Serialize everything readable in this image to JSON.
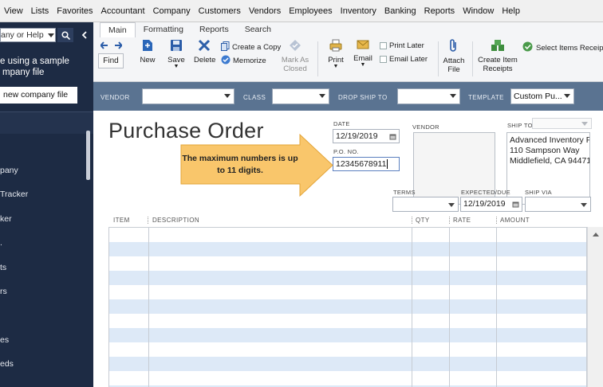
{
  "menu": [
    "View",
    "Lists",
    "Favorites",
    "Accountant",
    "Company",
    "Customers",
    "Vendors",
    "Employees",
    "Inventory",
    "Banking",
    "Reports",
    "Window",
    "Help"
  ],
  "leftnav": {
    "search_placeholder": "any or Help",
    "sample_msg_line1": "e using a sample",
    "sample_msg_line2": "mpany file",
    "new_company_button": "new company file",
    "items": [
      "pany",
      "Tracker",
      "ker",
      ".",
      "ts",
      "rs",
      "es",
      "eds"
    ]
  },
  "ribbon": {
    "tabs": [
      "Main",
      "Formatting",
      "Reports",
      "Search"
    ],
    "find": "Find",
    "new": "New",
    "save": "Save",
    "delete": "Delete",
    "create_copy": "Create a Copy",
    "memorize": "Memorize",
    "mark_as_closed_1": "Mark As",
    "mark_as_closed_2": "Closed",
    "print": "Print",
    "email": "Email",
    "print_later": "Print Later",
    "email_later": "Email Later",
    "attach_1": "Attach",
    "attach_2": "File",
    "create_receipts_1": "Create Item",
    "create_receipts_2": "Receipts",
    "select_items_receipt": "Select Items Receipt"
  },
  "formbar": {
    "vendor_label": "VENDOR",
    "class_label": "CLASS",
    "drop_ship_label": "DROP SHIP TO",
    "template_label": "TEMPLATE",
    "template_value": "Custom Pu..."
  },
  "form": {
    "title": "Purchase Order",
    "date_label": "DATE",
    "date_value": "12/19/2019",
    "po_label": "P.O. NO.",
    "po_value": "12345678911",
    "vendor_label": "VENDOR",
    "ship_to_label": "SHIP TO",
    "ship_to_address": [
      "Advanced Inventory File",
      "110 Sampson Way",
      "Middlefield, CA 94471"
    ],
    "terms_label": "TERMS",
    "expected_label": "EXPECTED/DUE",
    "expected_value": "12/19/2019",
    "ship_via_label": "SHIP VIA",
    "callout_line1": "The maximum numbers is up",
    "callout_line2": "to 11 digits."
  },
  "table": {
    "columns": [
      "ITEM",
      "DESCRIPTION",
      "QTY",
      "RATE",
      "AMOUNT"
    ]
  }
}
